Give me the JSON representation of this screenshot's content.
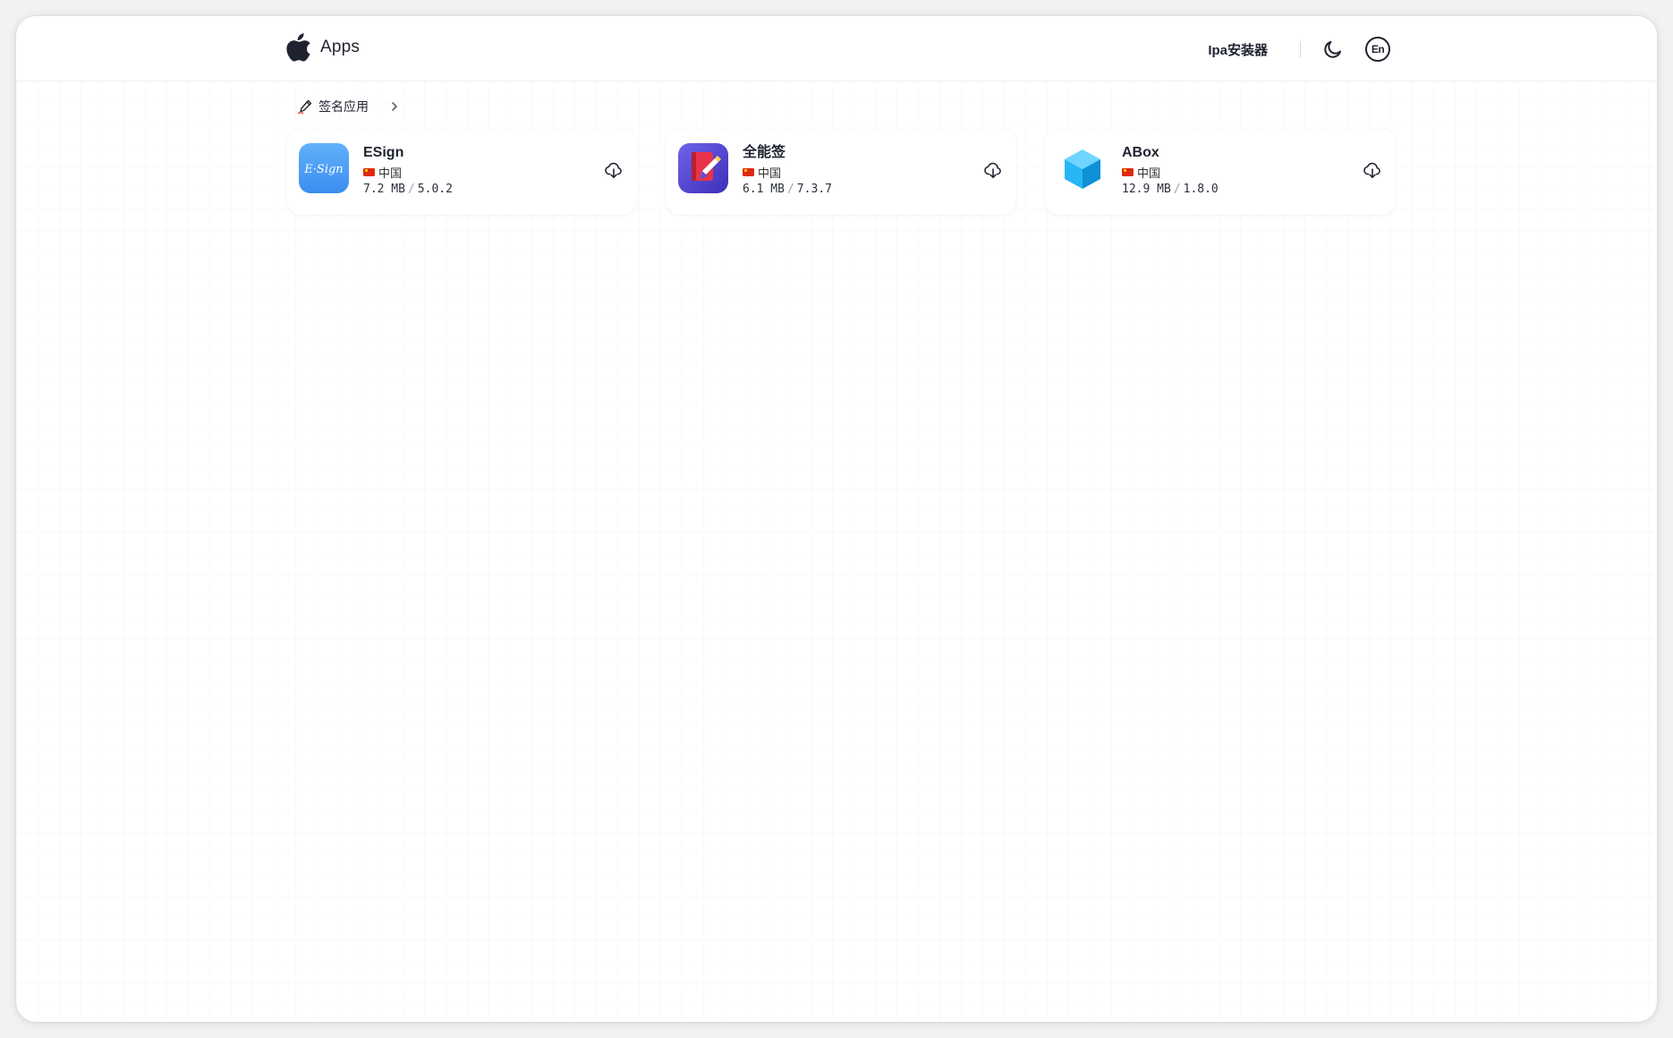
{
  "header": {
    "brand": "Apps",
    "installer_link": "Ipa安装器",
    "lang_label": "En"
  },
  "section": {
    "title": "签名应用"
  },
  "apps": [
    {
      "name": "ESign",
      "region": "中国",
      "size": "7.2 MB",
      "version": "5.0.2",
      "icon": "esign-icon",
      "icon_text": "E·Sign"
    },
    {
      "name": "全能签",
      "region": "中国",
      "size": "6.1 MB",
      "version": "7.3.7",
      "icon": "quanneng-icon"
    },
    {
      "name": "ABox",
      "region": "中国",
      "size": "12.9 MB",
      "version": "1.8.0",
      "icon": "abox-cube-icon"
    }
  ],
  "icons": {
    "brand": "apple-logo-icon",
    "theme": "moon-icon",
    "language": "language-en-icon",
    "section": "pen-icon",
    "more": "chevron-right-icon",
    "download": "cloud-download-icon"
  },
  "colors": {
    "text": "#1f2330",
    "page_bg": "#ffffff",
    "esign_blue": "#4a9cf5",
    "quanneng_purple": "#5b4fd6",
    "quanneng_red": "#e8334a",
    "abox_cyan": "#29b6f6"
  }
}
